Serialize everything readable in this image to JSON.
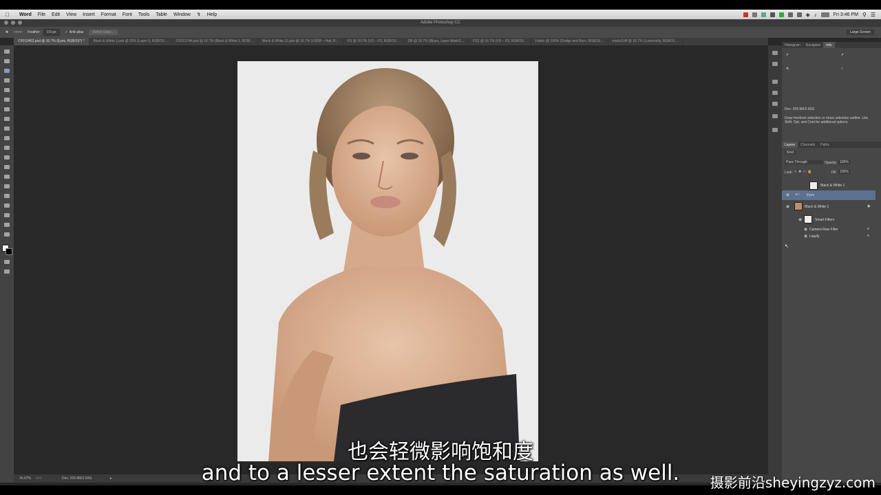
{
  "menubar": {
    "app_name": "Word",
    "items": [
      "File",
      "Edit",
      "View",
      "Insert",
      "Format",
      "Font",
      "Tools",
      "Table",
      "Window",
      "Help"
    ],
    "clock": "Fri 3:46 PM"
  },
  "window": {
    "title": "Adobe Photoshop CC"
  },
  "options_bar": {
    "feather_label": "Feather:",
    "feather_value": "0.5 px",
    "anti_alias_label": "Anti-alias",
    "refine_edge_label": "Refine Edge...",
    "workspace": "Large Screen"
  },
  "tabs": [
    "CF012452.psd @ 16.7% (Eyes, RGB/16*) *",
    "Black & White 1.psb @ 25% (Layer 0, RGB/16...",
    "CF012744.psd @ 16.7% (Black & White 1, RGB/...",
    "Black & White 11.psb @ 16.7% (VSDB – Hair, R...",
    "FS @ 16.7% (VS – FS, RGB/16...",
    "DB @ 16.7% (Blues, Layer Mask/1...",
    "FS2 @ 16.7% (VS – FS, RGB/16...",
    "Fabric @ 100% (Dodge and Burn, RGB/16...",
    "marla3.tiff @ 16.7% (Luminosity, RGB/16..."
  ],
  "statusbar": {
    "zoom": "16.67%",
    "doc": "Doc: 209.9M/2.60G"
  },
  "panels": {
    "top_tabs": [
      "Histogram",
      "Navigator",
      "Info"
    ],
    "info_doc": "Doc: 209.9M/2.60G",
    "info_help": "Draw freeform selection or move selection outline. Use Shift, Opt, and Cmd for additional options.",
    "layer_tabs": [
      "Layers",
      "Channels",
      "Paths"
    ],
    "kind_label": "Kind",
    "blend_mode": "Pass Through",
    "opacity_label": "Opacity:",
    "opacity_value": "100%",
    "lock_label": "Lock:",
    "fill_label": "Fill:",
    "fill_value": "100%",
    "layers": [
      {
        "name": "Black & White 1"
      },
      {
        "name": "Eyes"
      },
      {
        "name": "Black & White 1"
      },
      {
        "name": "Smart Filters"
      },
      {
        "name": "Camera Raw Filter"
      },
      {
        "name": "Liquify"
      }
    ]
  },
  "subtitles": {
    "cn": "也会轻微影响饱和度",
    "en": "and to a lesser extent the saturation as well.",
    "watermark": "摄影前沿sheyingzyz.com"
  }
}
